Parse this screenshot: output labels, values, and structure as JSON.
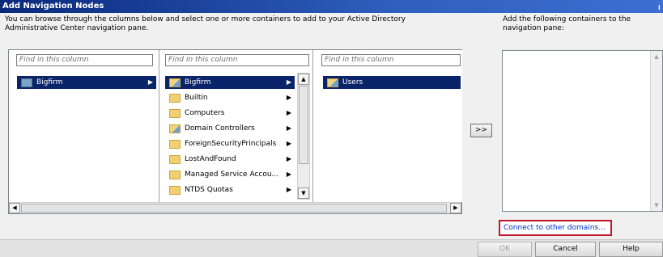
{
  "window": {
    "title": "Add Navigation Nodes",
    "title_bar_fragment": "i"
  },
  "instructions": {
    "line1": "You can browse through the columns below and select one or more containers to add to your Active Directory",
    "line2": "Administrative Center navigation pane.",
    "right_line1": "Add the following containers to the",
    "right_line2": "navigation pane:"
  },
  "columns": [
    {
      "find_placeholder": "Find in this column",
      "items": [
        {
          "label": "Bigfirm",
          "icon": "domain-icon",
          "selected": true,
          "has_children": true
        }
      ]
    },
    {
      "find_placeholder": "Find in this column",
      "items": [
        {
          "label": "Bigfirm",
          "icon": "folder-special-icon",
          "selected": true,
          "has_children": true
        },
        {
          "label": "Builtin",
          "icon": "folder-icon",
          "selected": false,
          "has_children": true
        },
        {
          "label": "Computers",
          "icon": "folder-icon",
          "selected": false,
          "has_children": true
        },
        {
          "label": "Domain Controllers",
          "icon": "folder-special-icon",
          "selected": false,
          "has_children": true
        },
        {
          "label": "ForeignSecurityPrincipals",
          "icon": "folder-icon",
          "selected": false,
          "has_children": true
        },
        {
          "label": "LostAndFound",
          "icon": "folder-icon",
          "selected": false,
          "has_children": true
        },
        {
          "label": "Managed Service Accou...",
          "icon": "folder-icon",
          "selected": false,
          "has_children": true
        },
        {
          "label": "NTDS Quotas",
          "icon": "folder-icon",
          "selected": false,
          "has_children": true
        }
      ]
    },
    {
      "find_placeholder": "Find in this column",
      "items": [
        {
          "label": "Users",
          "icon": "folder-special-icon",
          "selected": true,
          "has_children": false
        }
      ]
    }
  ],
  "add_button_label": ">>",
  "connect_link": "Connect to other domains...",
  "buttons": {
    "ok": "OK",
    "cancel": "Cancel",
    "help": "Help"
  },
  "colors": {
    "selection": "#0a246a",
    "link": "#0033cc",
    "highlight_border": "#c0172c"
  }
}
